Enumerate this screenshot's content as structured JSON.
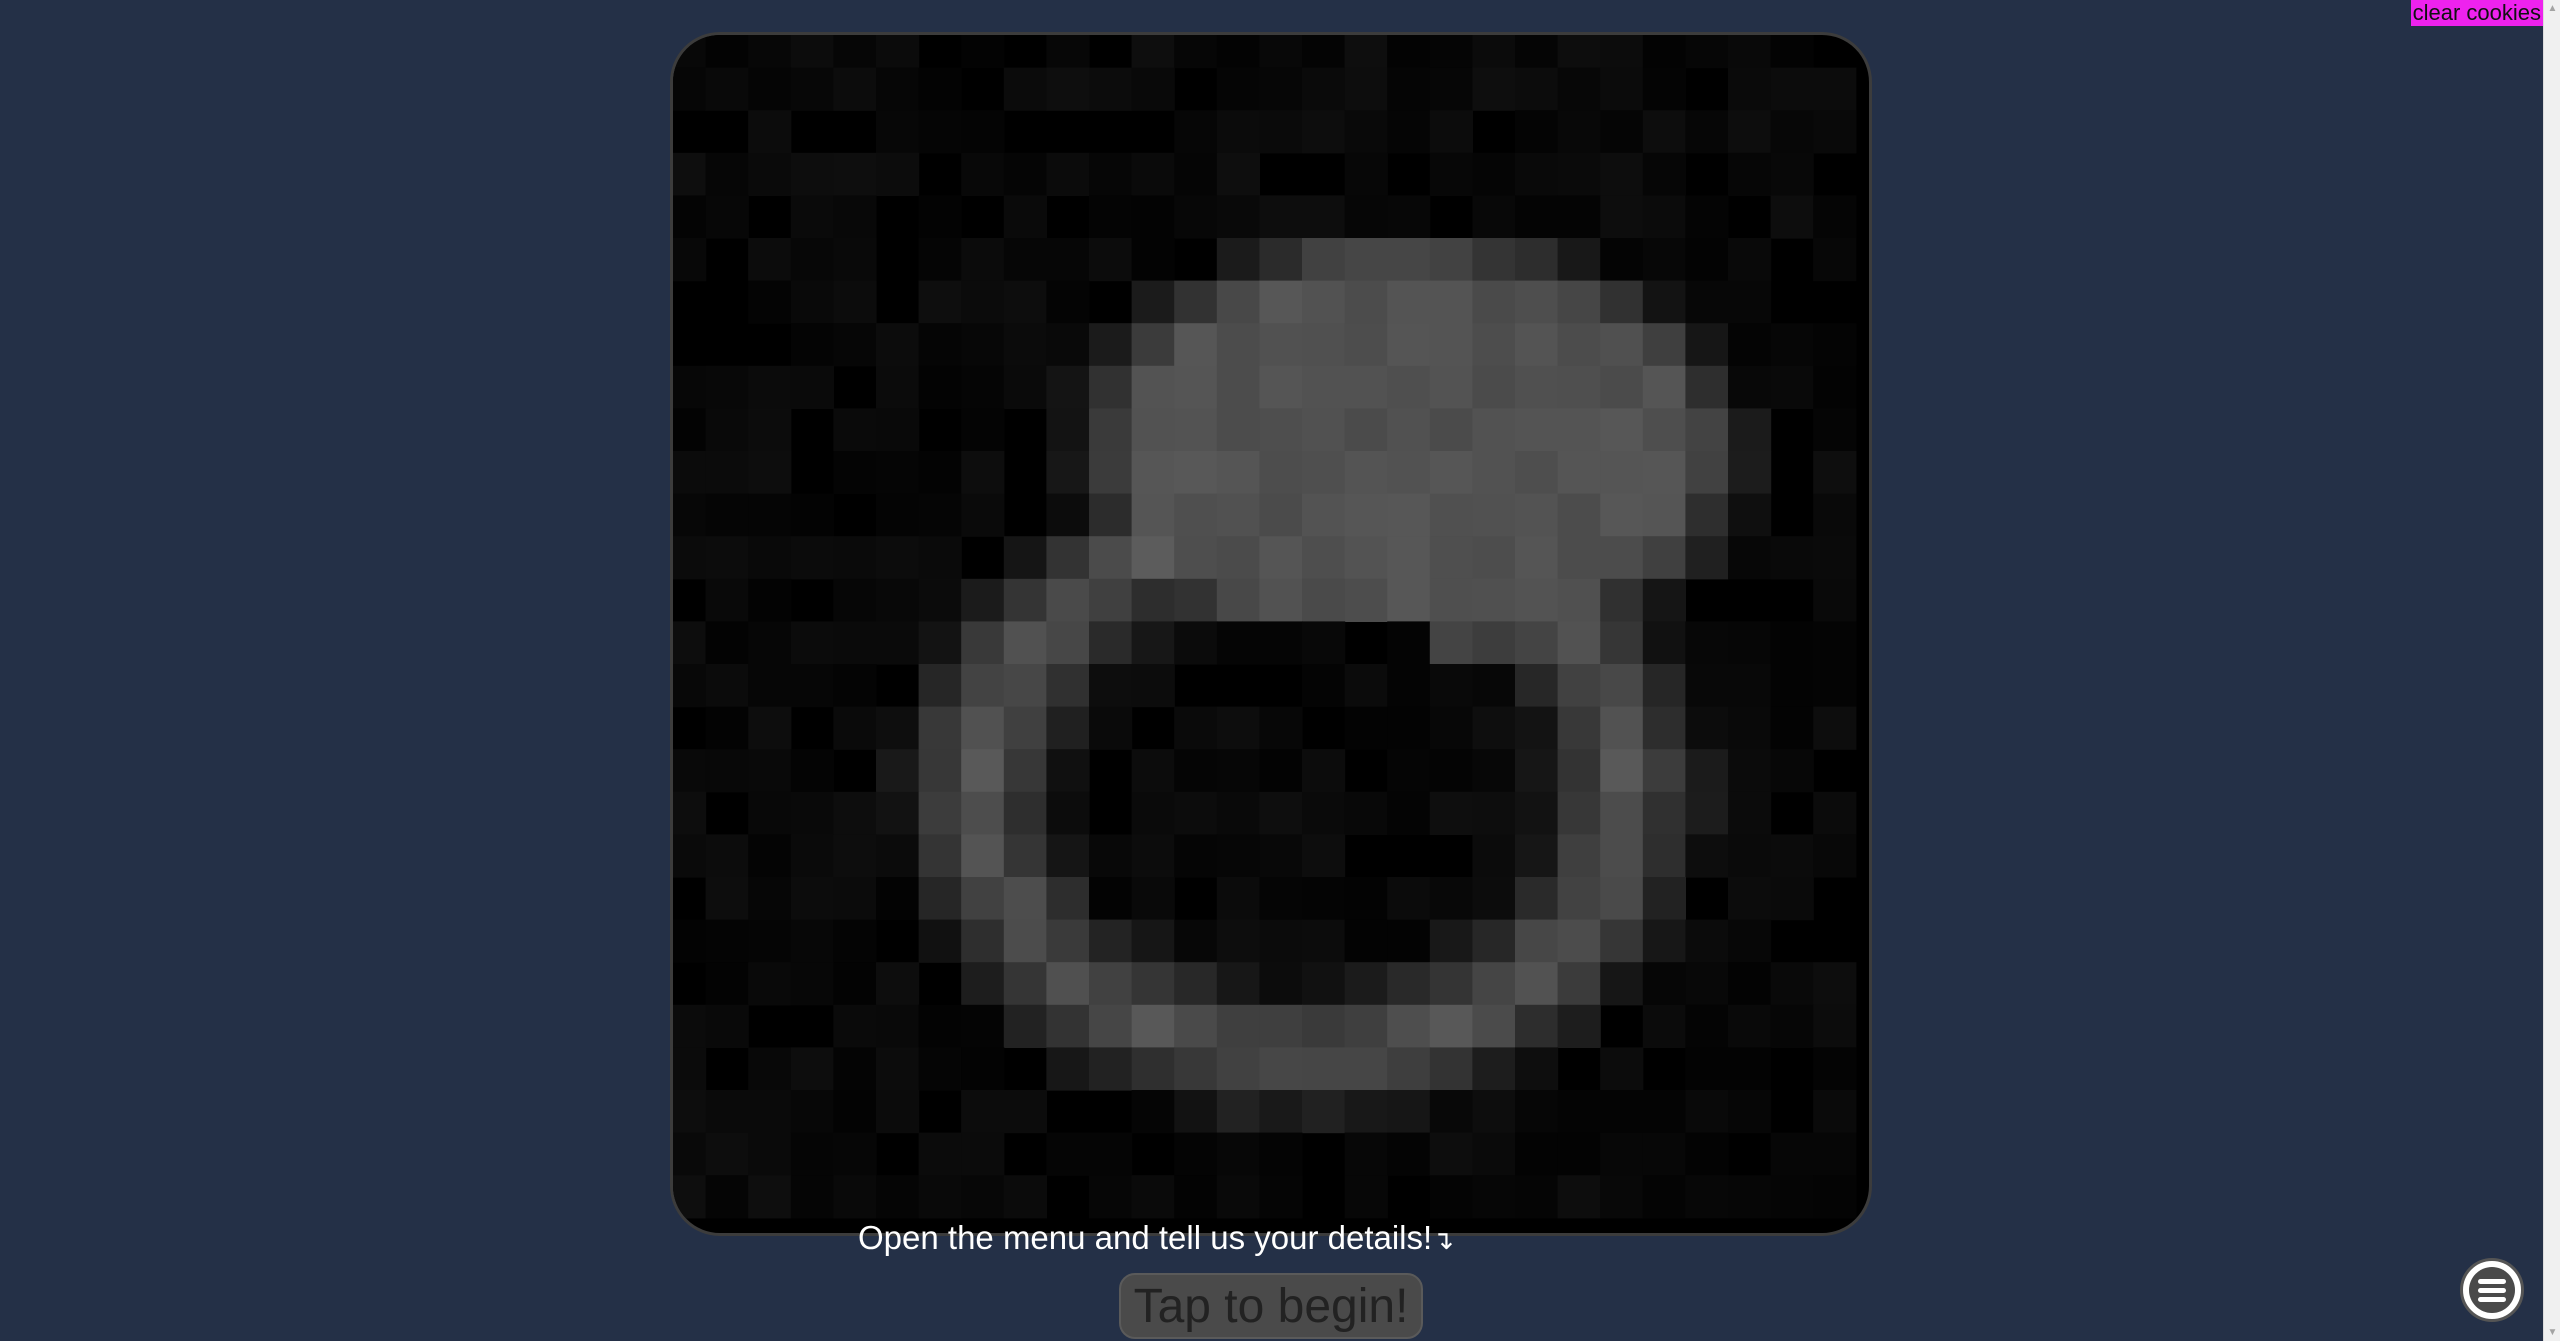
{
  "header": {
    "clear_cookies_label": "clear cookies"
  },
  "stage": {
    "prompt_text": "Open the menu and tell us your details!",
    "prompt_arrow": "↴",
    "start_label": "Tap to begin!"
  },
  "menu": {
    "icon": "hamburger-menu-icon"
  },
  "colors": {
    "background": "#243047",
    "clear_cookies_bg": "#ee22ee",
    "card_bg": "#000000",
    "button_bg": "#4a4a4a"
  }
}
